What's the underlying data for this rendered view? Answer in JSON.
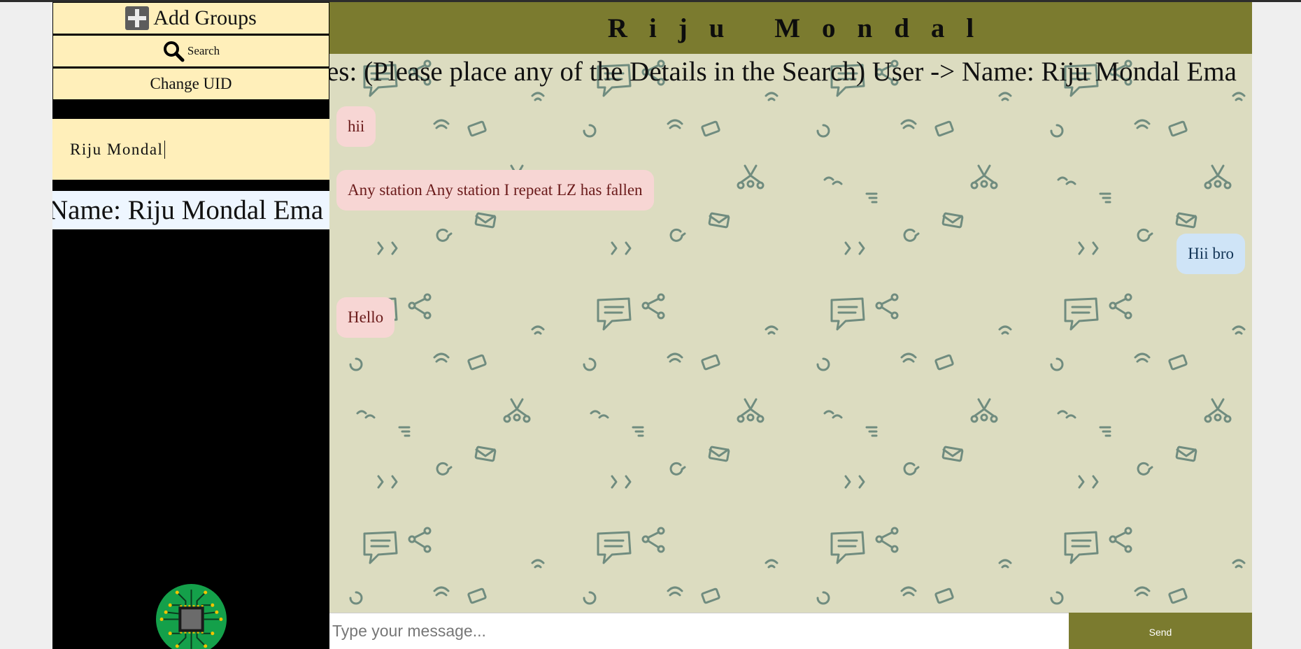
{
  "sidebar": {
    "add_groups_label": "Add Groups",
    "search_label": "Search",
    "change_uid_label": "Change UID",
    "current_user_name": "Riju Mondal",
    "details_strip_text": "Name: Riju Mondal Ema"
  },
  "header": {
    "title": "Riju Mondal"
  },
  "marquee": {
    "text": "es: (Please place any of the Details in the Search) User -> Name: Riju Mondal Ema"
  },
  "messages": [
    {
      "direction": "incoming",
      "text": "hii"
    },
    {
      "direction": "incoming",
      "text": "Any station Any station I repeat LZ has fallen"
    },
    {
      "direction": "outgoing",
      "text": "Hii bro"
    },
    {
      "direction": "incoming",
      "text": "Hello"
    }
  ],
  "composer": {
    "placeholder": "Type your message...",
    "send_label": "Send"
  },
  "colors": {
    "accent": "#7b7b2f",
    "sidebar_button_bg": "#ffefba",
    "incoming_bubble": "#f7d6d4",
    "outgoing_bubble": "#cfe4f7"
  },
  "icons": [
    "plus-icon",
    "search-icon",
    "circuit-chip-logo"
  ]
}
